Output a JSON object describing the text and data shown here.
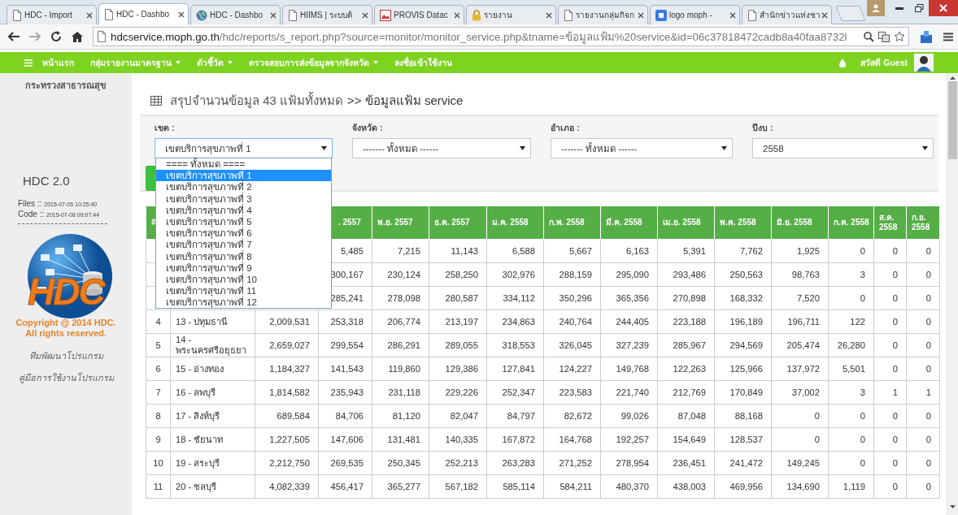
{
  "tabs": [
    {
      "title": "HDC - Import",
      "kind": "page",
      "selected": false
    },
    {
      "title": "HDC - Dashbo",
      "kind": "page",
      "selected": true
    },
    {
      "title": "HDC - Dashbo",
      "kind": "globe",
      "selected": false
    },
    {
      "title": "HIIMS | ระบบต้",
      "kind": "page",
      "selected": false
    },
    {
      "title": "PROVIS Datac",
      "kind": "image",
      "selected": false
    },
    {
      "title": "รายงาน",
      "kind": "lock",
      "selected": false
    },
    {
      "title": "รายงานกลุ่มกิจก",
      "kind": "page",
      "selected": false
    },
    {
      "title": "logo moph - ",
      "kind": "square",
      "selected": false
    },
    {
      "title": "สำนักข่าวแห่งชา",
      "kind": "page",
      "selected": false
    }
  ],
  "address_bar": {
    "host": "hdcservice.moph.go.th",
    "path": "/hdc/reports/s_report.php?source=monitor/monitor_service.php&tname=ข้อมูลแฟ้ม%20service&id=06c37818472cadb8a40faa8732l"
  },
  "nav": {
    "items": [
      {
        "label": "หน้าแรก",
        "dropdown": false
      },
      {
        "label": "กลุ่มรายงานมาตรฐาน",
        "dropdown": true
      },
      {
        "label": "ตัวชี้วัด",
        "dropdown": true
      },
      {
        "label": "ตรวจสอบการส่งข้อมูลจากจังหวัด",
        "dropdown": true
      },
      {
        "label": "ลงชื่อเข้าใช้งาน",
        "dropdown": false
      }
    ],
    "greeting": "สวัสดี Guest"
  },
  "sidebar": {
    "ministry": "กระทรวงสาธารณสุข",
    "version": "HDC 2.0",
    "files": {
      "label": "Files ::",
      "time": "2015-07-05 10:25:40"
    },
    "code": {
      "label": "Code ::",
      "time": "2015-07-08 09:07:44"
    },
    "logo_text": "HDC",
    "copyright": [
      "Copyright @ 2014 HDC.",
      "All rights reserved."
    ],
    "links": [
      "ทีมพัฒนาโปรแกรม",
      "คู่มือการใช้งานโปรแกรม"
    ]
  },
  "report": {
    "breadcrumb": "สรุปจำนวนข้อมูล 43 แฟ้มทั้งหมด",
    "title": ">> ข้อมูลแฟ้ม service",
    "filters": [
      {
        "label": "เขต :",
        "value": "เขตบริการสุขภาพที่ 1",
        "open": true,
        "options": [
          {
            "label": "==== ทั้งหมด ====",
            "selected": false
          },
          {
            "label": "เขตบริการสุขภาพที่ 1",
            "selected": true
          },
          {
            "label": "เขตบริการสุขภาพที่ 2",
            "selected": false
          },
          {
            "label": "เขตบริการสุขภาพที่ 3",
            "selected": false
          },
          {
            "label": "เขตบริการสุขภาพที่ 4",
            "selected": false
          },
          {
            "label": "เขตบริการสุขภาพที่ 5",
            "selected": false
          },
          {
            "label": "เขตบริการสุขภาพที่ 6",
            "selected": false
          },
          {
            "label": "เขตบริการสุขภาพที่ 7",
            "selected": false
          },
          {
            "label": "เขตบริการสุขภาพที่ 8",
            "selected": false
          },
          {
            "label": "เขตบริการสุขภาพที่ 9",
            "selected": false
          },
          {
            "label": "เขตบริการสุขภาพที่ 10",
            "selected": false
          },
          {
            "label": "เขตบริการสุขภาพที่ 11",
            "selected": false
          },
          {
            "label": "เขตบริการสุขภาพที่ 12",
            "selected": false
          }
        ]
      },
      {
        "label": "จังหวัด :",
        "value": "------- ทั้งหมด ------",
        "open": false
      },
      {
        "label": "อำเภอ :",
        "value": "------- ทั้งหมด ------",
        "open": false
      },
      {
        "label": "ปีงบ :",
        "value": "2558",
        "open": false
      }
    ],
    "table": {
      "columns": [
        "#",
        null,
        null,
        ". 2557",
        "พ.ย. 2557",
        "ธ.ค. 2557",
        "ม.ค. 2558",
        "ก.พ. 2558",
        "มี.ค. 2558",
        "เม.ย. 2558",
        "พ.ค. 2558",
        "มิ.ย. 2558",
        "ก.ค. 2558",
        "ส.ค. 2558",
        "ก.ย. 2558"
      ],
      "rows": [
        [
          null,
          null,
          null,
          "5,485",
          "7,215",
          "11,143",
          "6,588",
          "5,667",
          "6,163",
          "5,391",
          "7,762",
          "1,925",
          "0",
          "0",
          "0"
        ],
        [
          null,
          null,
          null,
          "300,167",
          "230,124",
          "258,250",
          "302,976",
          "288,159",
          "295,090",
          "293,486",
          "250,563",
          "98,763",
          "3",
          "0",
          "0"
        ],
        [
          null,
          null,
          null,
          "285,241",
          "278,098",
          "280,587",
          "334,112",
          "350,296",
          "365,356",
          "270,898",
          "168,332",
          "7,520",
          "0",
          "0",
          "0"
        ],
        [
          "4",
          "13 - ปทุมธานี",
          "2,009,531",
          "253,318",
          "206,774",
          "213,197",
          "234,863",
          "240,764",
          "244,405",
          "223,188",
          "196,189",
          "196,711",
          "122",
          "0",
          "0"
        ],
        [
          "5",
          "14 - พระนครศรีอยุธยา",
          "2,659,027",
          "299,554",
          "286,291",
          "289,055",
          "318,553",
          "326,045",
          "327,239",
          "285,967",
          "294,569",
          "205,474",
          "26,280",
          "0",
          "0"
        ],
        [
          "6",
          "15 - อ่างทอง",
          "1,184,327",
          "141,543",
          "119,860",
          "129,386",
          "127,841",
          "124,227",
          "149,768",
          "122,263",
          "125,966",
          "137,972",
          "5,501",
          "0",
          "0"
        ],
        [
          "7",
          "16 - ลพบุรี",
          "1,814,582",
          "235,943",
          "231,118",
          "229,226",
          "252,347",
          "223,583",
          "221,740",
          "212,769",
          "170,849",
          "37,002",
          "3",
          "1",
          "1"
        ],
        [
          "8",
          "17 - สิงห์บุรี",
          "689,584",
          "84,706",
          "81,120",
          "82,047",
          "84,797",
          "82,672",
          "99,026",
          "87,048",
          "88,168",
          "0",
          "0",
          "0",
          "0"
        ],
        [
          "9",
          "18 - ชัยนาท",
          "1,227,505",
          "147,606",
          "131,481",
          "140,335",
          "167,872",
          "164,768",
          "192,257",
          "154,649",
          "128,537",
          "0",
          "0",
          "0",
          "0"
        ],
        [
          "10",
          "19 - สระบุรี",
          "2,212,750",
          "269,535",
          "250,345",
          "252,213",
          "263,283",
          "271,252",
          "278,954",
          "236,451",
          "241,472",
          "149,245",
          "0",
          "0",
          "0"
        ],
        [
          "11",
          "20 - ชลบุรี",
          "4,082,339",
          "456,417",
          "365,277",
          "567,182",
          "585,114",
          "584,211",
          "480,370",
          "438,003",
          "469,956",
          "134,690",
          "1,119",
          "0",
          "0"
        ]
      ]
    }
  }
}
